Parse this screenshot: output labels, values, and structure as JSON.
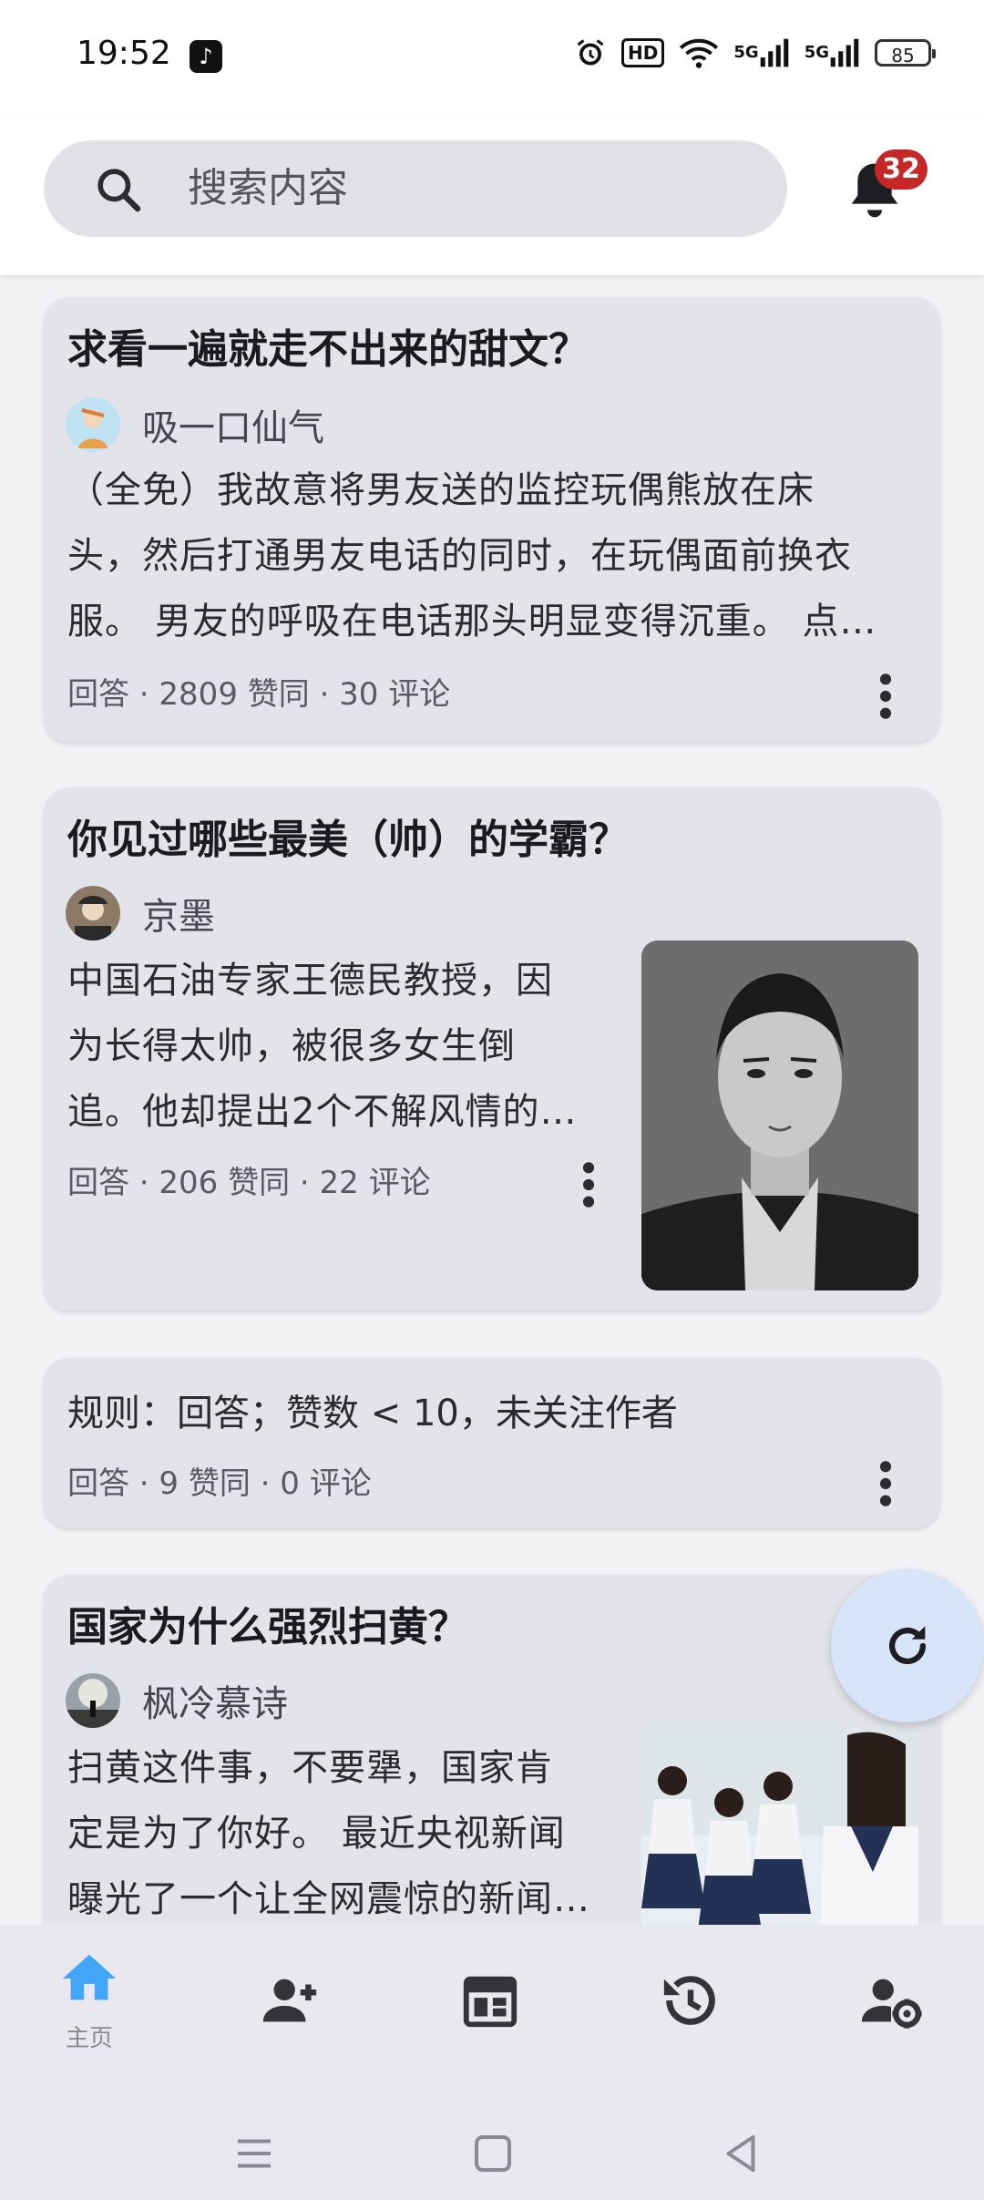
{
  "status_bar": {
    "time": "19:52",
    "app_icon": "tiktok-icon",
    "icons": [
      "alarm-icon",
      "hd-icon",
      "wifi-icon",
      "signal-5g-icon",
      "signal-5g-icon"
    ],
    "hd_label": "HD",
    "net1": "5G",
    "net2": "5G",
    "battery": "85"
  },
  "header": {
    "search_placeholder": "搜索内容",
    "notification_count": "32"
  },
  "feed": [
    {
      "title": "求看一遍就走不出来的甜文？",
      "author": "吸一口仙气",
      "excerpt": [
        "（全免）我故意将男友送的监控玩偶熊放在床",
        "头，然后打通男友电话的同时，在玩偶面前换衣",
        "服。 男友的呼吸在电话那头明显变得沉重。 点…"
      ],
      "meta": "回答 · 2809 赞同 · 30 评论"
    },
    {
      "title": "你见过哪些最美（帅）的学霸？",
      "author": "京墨",
      "excerpt": [
        "中国石油专家王德民教授，因",
        "为长得太帅，被很多女生倒",
        "追。他却提出2个不解风情的…"
      ],
      "meta": "回答 · 206 赞同 · 22 评论"
    },
    {
      "rule_text": "规则：回答；赞数 < 10，未关注作者",
      "meta": "回答 · 9 赞同 · 0 评论"
    },
    {
      "title": "国家为什么强烈扫黄？",
      "author": "枫冷慕诗",
      "excerpt": [
        "扫黄这件事，不要犟，国家肯",
        "定是为了你好。 最近央视新闻",
        "曝光了一个让全网震惊的新闻…"
      ]
    }
  ],
  "bottom_nav": {
    "items": [
      {
        "icon": "home-icon",
        "label": "主页",
        "active": true
      },
      {
        "icon": "add-user-icon"
      },
      {
        "icon": "calendar-icon"
      },
      {
        "icon": "history-icon"
      },
      {
        "icon": "user-settings-icon"
      }
    ],
    "active_color": "#42a5f5"
  },
  "colors": {
    "card_bg": "#e3e3ea",
    "badge": "#c62828",
    "fab_bg": "#d8e4f8"
  }
}
